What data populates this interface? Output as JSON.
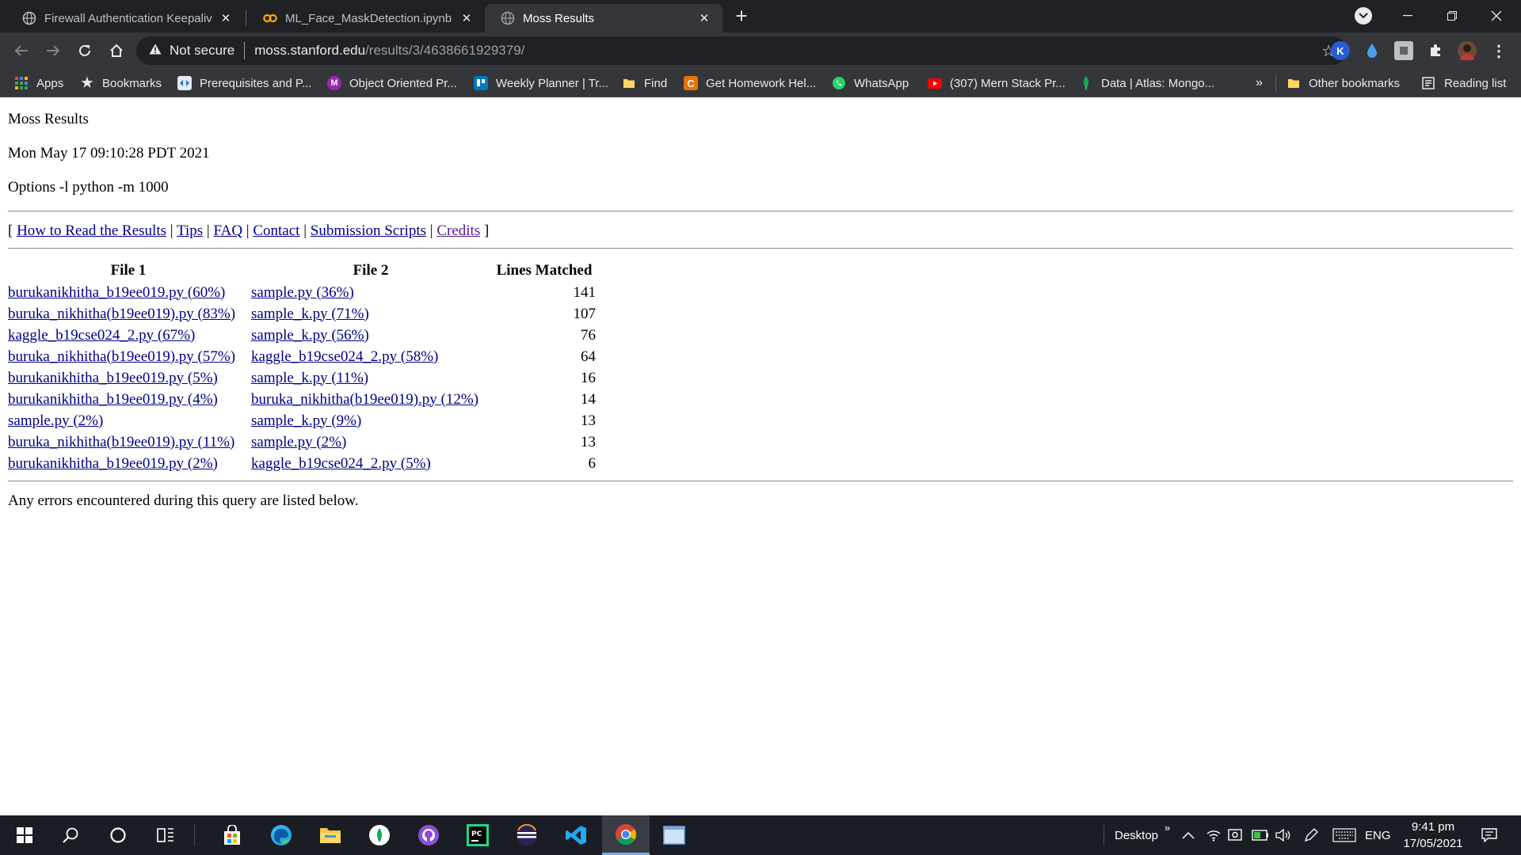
{
  "browser": {
    "tabs": [
      {
        "title": "Firewall Authentication Keepalive",
        "icon": "globe-icon",
        "active": false
      },
      {
        "title": "ML_Face_MaskDetection.ipynb - C",
        "icon": "colab-icon",
        "active": false
      },
      {
        "title": "Moss Results",
        "icon": "globe-icon",
        "active": true
      }
    ],
    "address": {
      "security": "Not secure",
      "host": "moss.stanford.edu",
      "path": "/results/3/4638661929379/"
    },
    "bookmarks": [
      {
        "label": "Apps",
        "icon": "apps-grid-icon"
      },
      {
        "label": "Bookmarks",
        "icon": "star-icon"
      },
      {
        "label": "Prerequisites and P...",
        "icon": "prereq-icon"
      },
      {
        "label": "Object Oriented Pr...",
        "icon": "m-badge-icon"
      },
      {
        "label": "Weekly Planner | Tr...",
        "icon": "trello-icon"
      },
      {
        "label": "Find",
        "icon": "folder-icon"
      },
      {
        "label": "Get Homework Hel...",
        "icon": "chegg-icon"
      },
      {
        "label": "WhatsApp",
        "icon": "whatsapp-icon"
      },
      {
        "label": "(307) Mern Stack Pr...",
        "icon": "youtube-icon"
      },
      {
        "label": "Data | Atlas: Mongo...",
        "icon": "mongodb-leaf-icon"
      }
    ],
    "bookmarks_overflow": "»",
    "other_bookmarks": "Other bookmarks",
    "reading_list": "Reading list"
  },
  "page": {
    "title": "Moss Results",
    "date": "Mon May 17 09:10:28 PDT 2021",
    "options": "Options -l python -m 1000",
    "nav": {
      "open": "[",
      "close": "]",
      "sep": "|",
      "links": [
        "How to Read the Results",
        "Tips",
        "FAQ",
        "Contact",
        "Submission Scripts",
        "Credits"
      ]
    },
    "table": {
      "headers": [
        "File 1",
        "File 2",
        "Lines Matched"
      ],
      "rows": [
        [
          "burukanikhitha_b19ee019.py (60%)",
          "sample.py (36%)",
          "141"
        ],
        [
          "buruka_nikhitha(b19ee019).py (83%)",
          "sample_k.py (71%)",
          "107"
        ],
        [
          "kaggle_b19cse024_2.py (67%)",
          "sample_k.py (56%)",
          "76"
        ],
        [
          "buruka_nikhitha(b19ee019).py (57%)",
          "kaggle_b19cse024_2.py (58%)",
          "64"
        ],
        [
          "burukanikhitha_b19ee019.py (5%)",
          "sample_k.py (11%)",
          "16"
        ],
        [
          "burukanikhitha_b19ee019.py (4%)",
          "buruka_nikhitha(b19ee019).py (12%)",
          "14"
        ],
        [
          "sample.py (2%)",
          "sample_k.py (9%)",
          "13"
        ],
        [
          "buruka_nikhitha(b19ee019).py (11%)",
          "sample.py (2%)",
          "13"
        ],
        [
          "burukanikhitha_b19ee019.py (2%)",
          "kaggle_b19cse024_2.py (5%)",
          "6"
        ]
      ]
    },
    "errors_note": "Any errors encountered during this query are listed below."
  },
  "taskbar": {
    "apps": [
      "windows-start-icon",
      "search-icon",
      "cortana-icon",
      "task-view-icon",
      "store-icon",
      "edge-icon",
      "file-explorer-icon",
      "mongodb-compass-icon",
      "github-desktop-icon",
      "pycharm-icon",
      "eclipse-icon",
      "vscode-icon",
      "chrome-icon",
      "window-app-icon"
    ],
    "desktop_label": "Desktop",
    "desktop_chevron": "»",
    "language": "ENG",
    "time": "9:41 pm",
    "date": "17/05/2021"
  },
  "colors": {
    "tab_strip": "#202124",
    "toolbar": "#35363a",
    "link": "#00008b",
    "visited_link": "#551a8b",
    "taskbar": "#1b1d24"
  }
}
